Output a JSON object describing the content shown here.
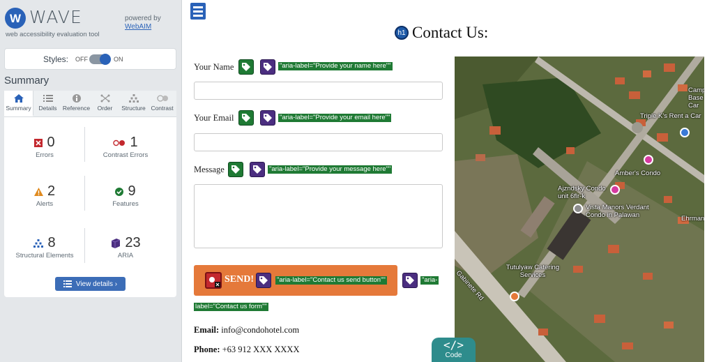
{
  "wave": {
    "logo_letter": "W",
    "logo_text": "WAVE",
    "subtitle": "web accessibility evaluation tool",
    "powered_by": "powered by",
    "webaim_link": "WebAIM",
    "styles_label": "Styles:",
    "off_label": "OFF",
    "on_label": "ON",
    "summary_heading": "Summary",
    "tabs": [
      {
        "label": "Summary",
        "icon": "home-icon"
      },
      {
        "label": "Details",
        "icon": "list-icon"
      },
      {
        "label": "Reference",
        "icon": "info-icon"
      },
      {
        "label": "Order",
        "icon": "order-icon"
      },
      {
        "label": "Structure",
        "icon": "structure-icon"
      },
      {
        "label": "Contrast",
        "icon": "contrast-icon"
      }
    ],
    "stats": {
      "errors": {
        "value": "0",
        "label": "Errors"
      },
      "contrast_errors": {
        "value": "1",
        "label": "Contrast Errors"
      },
      "alerts": {
        "value": "2",
        "label": "Alerts"
      },
      "features": {
        "value": "9",
        "label": "Features"
      },
      "structural": {
        "value": "8",
        "label": "Structural Elements"
      },
      "aria": {
        "value": "23",
        "label": "ARIA"
      }
    },
    "view_details": "View details ›",
    "colors": {
      "error": "#c3282e",
      "alert": "#e08a1e",
      "feature": "#1f7a34",
      "structure": "#2a62b8",
      "aria": "#4b2e80",
      "accent": "#3c6db7"
    }
  },
  "page": {
    "h1_badge": "h1",
    "title": "Contact Us:",
    "name_label": "Your Name",
    "name_aria": "\"aria-label=\"Provide your name here\"\"",
    "email_label": "Your Email",
    "email_aria": "\"aria-label=\"Provide your email here\"\"",
    "message_label": "Message",
    "message_aria": "\"aria-label=\"Provide your message here\"\"",
    "send_label": "SEND!",
    "send_aria": "\"aria-label=\"Contact us send button\"\"",
    "form_aria_start": "\"aria-",
    "form_aria_end": "label=\"Contact us form\"\"",
    "email_info_label": "Email:",
    "email_info_value": "info@condohotel.com",
    "phone_info_label": "Phone:",
    "phone_info_value": "+63 912 XXX XXXX",
    "code_label": "Code",
    "code_icon": "</>"
  },
  "map": {
    "labels": [
      "Camp Base Car",
      "Triple K's Rent a Car",
      "Amber's Condo",
      "Ajzndsky Condo unit 6flr-k",
      "Vista Manors Verdant Condo in Palawan",
      "Ehrmann",
      "Gabinete Rd",
      "Tutulyaw Catering Services"
    ]
  }
}
